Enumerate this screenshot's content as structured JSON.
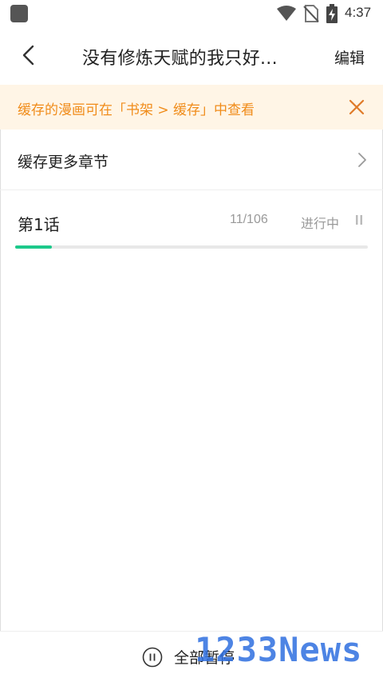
{
  "status_bar": {
    "time": "4:37",
    "icons": [
      "app-notification-icon",
      "wifi-icon",
      "no-sim-icon",
      "battery-charging-icon"
    ]
  },
  "nav": {
    "back_icon": "back-arrow-icon",
    "title": "没有修炼天赋的我只好...",
    "edit_label": "编辑"
  },
  "banner": {
    "text": "缓存的漫画可在「书架 > 缓存」中查看",
    "close_icon": "close-icon",
    "color": "#f08c1a",
    "background": "#fff5e6"
  },
  "more_chapters": {
    "label": "缓存更多章节",
    "chevron_icon": "chevron-right-icon"
  },
  "downloads": [
    {
      "title": "第1话",
      "progress_text": "11/106",
      "progress": 0.104,
      "status": "进行中",
      "pause_icon": "pause-icon",
      "accent": "#1dc98b"
    }
  ],
  "bottom_bar": {
    "pause_all_label": "全部暂停",
    "pause_all_icon": "pause-circle-icon"
  },
  "watermark": {
    "text": "1233News",
    "color": "#2f6fe0"
  }
}
